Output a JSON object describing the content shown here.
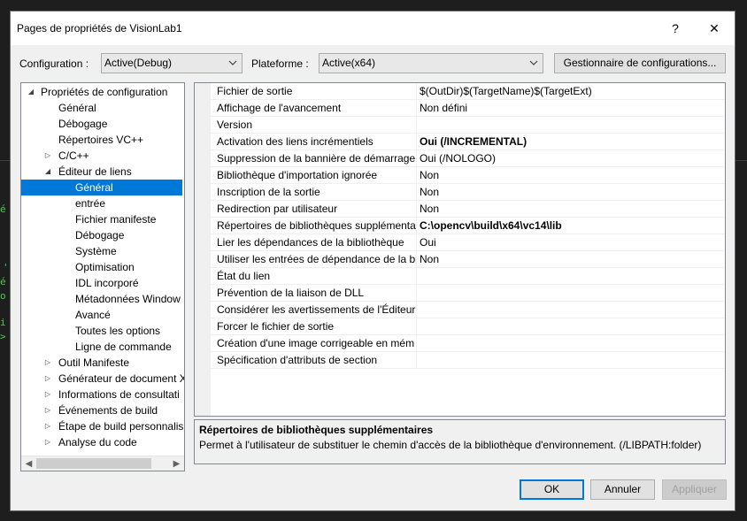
{
  "window": {
    "title": "Pages de propriétés de VisionLab1",
    "help_label": "?",
    "close_label": "✕"
  },
  "toolbar": {
    "configuration_label": "Configuration :",
    "configuration_value": "Active(Debug)",
    "platform_label": "Plateforme :",
    "platform_value": "Active(x64)",
    "config_manager_label": "Gestionnaire de configurations..."
  },
  "tree": {
    "items": [
      {
        "label": "Propriétés de configuration",
        "level": 0,
        "toggle": "expanded"
      },
      {
        "label": "Général",
        "level": 1,
        "toggle": ""
      },
      {
        "label": "Débogage",
        "level": 1,
        "toggle": ""
      },
      {
        "label": "Répertoires VC++",
        "level": 1,
        "toggle": ""
      },
      {
        "label": "C/C++",
        "level": 1,
        "toggle": "collapsed"
      },
      {
        "label": "Éditeur de liens",
        "level": 1,
        "toggle": "expanded"
      },
      {
        "label": "Général",
        "level": 2,
        "toggle": "",
        "selected": true
      },
      {
        "label": "entrée",
        "level": 2,
        "toggle": ""
      },
      {
        "label": "Fichier manifeste",
        "level": 2,
        "toggle": ""
      },
      {
        "label": "Débogage",
        "level": 2,
        "toggle": ""
      },
      {
        "label": "Système",
        "level": 2,
        "toggle": ""
      },
      {
        "label": "Optimisation",
        "level": 2,
        "toggle": ""
      },
      {
        "label": "IDL incorporé",
        "level": 2,
        "toggle": ""
      },
      {
        "label": "Métadonnées Window",
        "level": 2,
        "toggle": ""
      },
      {
        "label": "Avancé",
        "level": 2,
        "toggle": ""
      },
      {
        "label": "Toutes les options",
        "level": 2,
        "toggle": ""
      },
      {
        "label": "Ligne de commande",
        "level": 2,
        "toggle": ""
      },
      {
        "label": "Outil Manifeste",
        "level": 1,
        "toggle": "collapsed"
      },
      {
        "label": "Générateur de document X",
        "level": 1,
        "toggle": "collapsed"
      },
      {
        "label": "Informations de consultati",
        "level": 1,
        "toggle": "collapsed"
      },
      {
        "label": "Événements de build",
        "level": 1,
        "toggle": "collapsed"
      },
      {
        "label": "Étape de build personnalis",
        "level": 1,
        "toggle": "collapsed"
      },
      {
        "label": "Analyse du code",
        "level": 1,
        "toggle": "collapsed"
      }
    ]
  },
  "properties": [
    {
      "name": "Fichier de sortie",
      "value": "$(OutDir)$(TargetName)$(TargetExt)",
      "bold": false
    },
    {
      "name": "Affichage de l'avancement",
      "value": "Non défini",
      "bold": false
    },
    {
      "name": "Version",
      "value": "",
      "bold": false
    },
    {
      "name": "Activation des liens incrémentiels",
      "value": "Oui (/INCREMENTAL)",
      "bold": true
    },
    {
      "name": "Suppression de la bannière de démarrage",
      "value": "Oui (/NOLOGO)",
      "bold": false
    },
    {
      "name": "Bibliothèque d'importation ignorée",
      "value": "Non",
      "bold": false
    },
    {
      "name": "Inscription de la sortie",
      "value": "Non",
      "bold": false
    },
    {
      "name": "Redirection par utilisateur",
      "value": "Non",
      "bold": false
    },
    {
      "name": "Répertoires de bibliothèques supplémentai",
      "value": "C:\\opencv\\build\\x64\\vc14\\lib",
      "bold": true
    },
    {
      "name": "Lier les dépendances de la bibliothèque",
      "value": "Oui",
      "bold": false
    },
    {
      "name": "Utiliser les entrées de dépendance de la bibl",
      "value": "Non",
      "bold": false
    },
    {
      "name": "État du lien",
      "value": "",
      "bold": false
    },
    {
      "name": "Prévention de la liaison de DLL",
      "value": "",
      "bold": false
    },
    {
      "name": "Considérer les avertissements de l'Éditeur d",
      "value": "",
      "bold": false
    },
    {
      "name": "Forcer le fichier de sortie",
      "value": "",
      "bold": false
    },
    {
      "name": "Création d'une image corrigeable en mém",
      "value": "",
      "bold": false
    },
    {
      "name": "Spécification d'attributs de section",
      "value": "",
      "bold": false
    }
  ],
  "description": {
    "title": "Répertoires de bibliothèques supplémentaires",
    "text": "Permet à l'utilisateur de substituer le chemin d'accès de la bibliothèque d'environnement. (/LIBPATH:folder)"
  },
  "footer": {
    "ok_label": "OK",
    "cancel_label": "Annuler",
    "apply_label": "Appliquer"
  },
  "colors": {
    "selection": "#0078d7",
    "dialog_bg": "#f0f0f0",
    "ide_bg": "#1e1e1e"
  }
}
